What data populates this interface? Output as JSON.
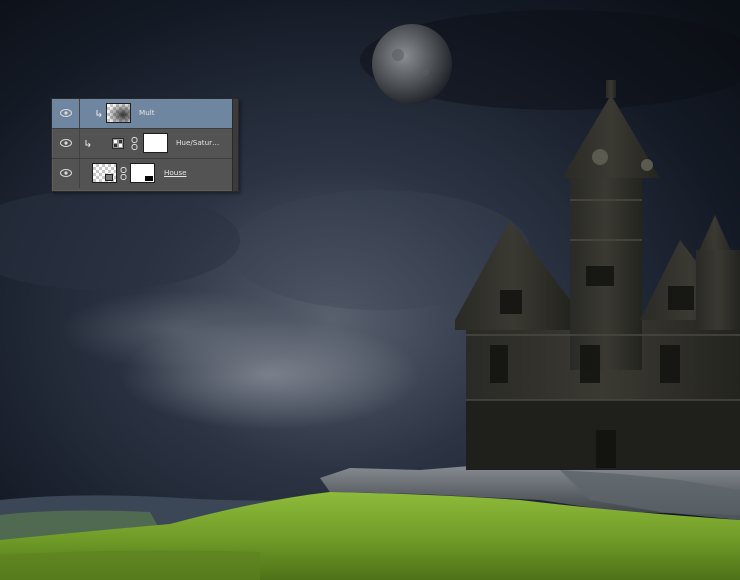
{
  "scene": {
    "description_icons": [
      "moon-icon",
      "mansion",
      "grass-hill",
      "rocks"
    ]
  },
  "layers_panel": {
    "layers": [
      {
        "name": "Mult",
        "visible": true,
        "selected": true,
        "clipped": true,
        "underlined": false
      },
      {
        "name": "Hue/Satur…",
        "visible": true,
        "selected": false,
        "clipped": true,
        "underlined": false
      },
      {
        "name": "House",
        "visible": true,
        "selected": false,
        "clipped": false,
        "underlined": true
      }
    ]
  },
  "colors": {
    "selected_row": "#6f86a1",
    "panel_bg": "#535353",
    "grass": "#7ea82e",
    "sky": "#1b2232"
  }
}
